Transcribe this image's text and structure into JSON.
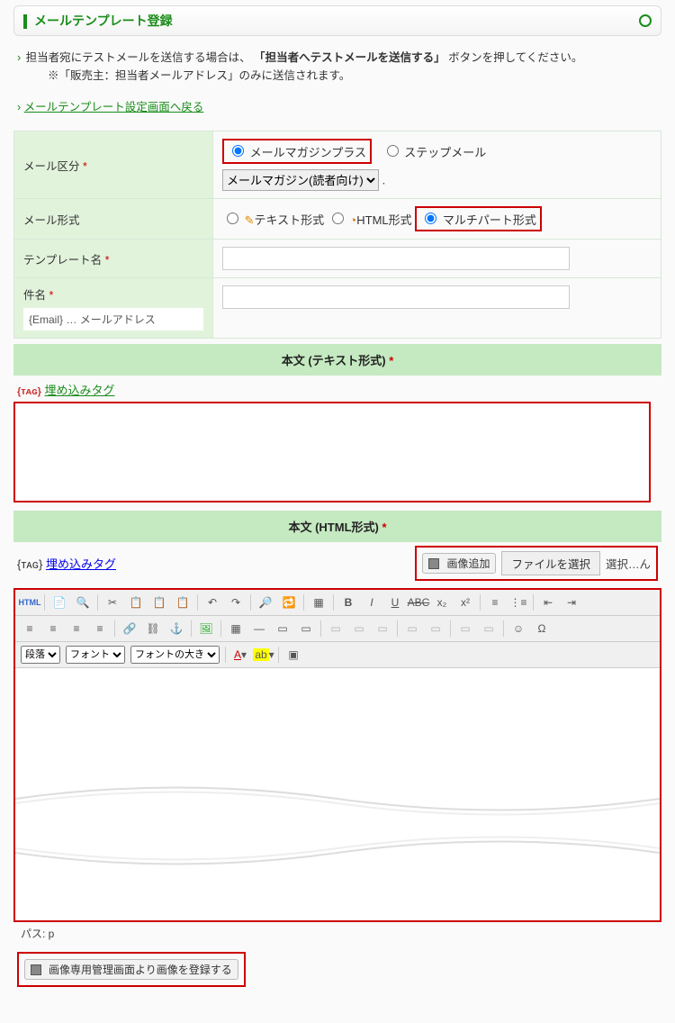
{
  "header": {
    "title": "メールテンプレート登録"
  },
  "notes": {
    "line1_pre": "担当者宛にテストメールを送信する場合は、",
    "line1_bold": "「担当者へテストメールを送信する」",
    "line1_post": "ボタンを押してください。",
    "line2": "※「販売主：担当者メールアドレス」のみに送信されます。"
  },
  "backlink": "メールテンプレート設定画面へ戻る",
  "fields": {
    "mail_kubun": {
      "label": "メール区分",
      "opt1": "メールマガジンプラス",
      "opt2": "ステップメール",
      "select": "メールマガジン(読者向け)"
    },
    "mail_format": {
      "label": "メール形式",
      "opt1": "テキスト形式",
      "opt2": "HTML形式",
      "opt3": "マルチパート形式"
    },
    "template_name": {
      "label": "テンプレート名"
    },
    "subject": {
      "label": "件名",
      "hint": "{Email} … メールアドレス"
    }
  },
  "section": {
    "text_title": "本文 (テキスト形式)",
    "html_title": "本文 (HTML形式)"
  },
  "embed_tag_label": "埋め込みタグ",
  "embed_tag_prefix": "{ᴛᴀɢ}",
  "img_add": {
    "btn": "画像追加",
    "file_btn": "ファイルを選択",
    "file_label": "選択…ん"
  },
  "editor": {
    "para": "段落",
    "font": "フォント",
    "size": "フォントの大き",
    "html_btn": "HTML"
  },
  "path": "パス: p",
  "img_reg_btn": "画像専用管理画面より画像を登録する"
}
